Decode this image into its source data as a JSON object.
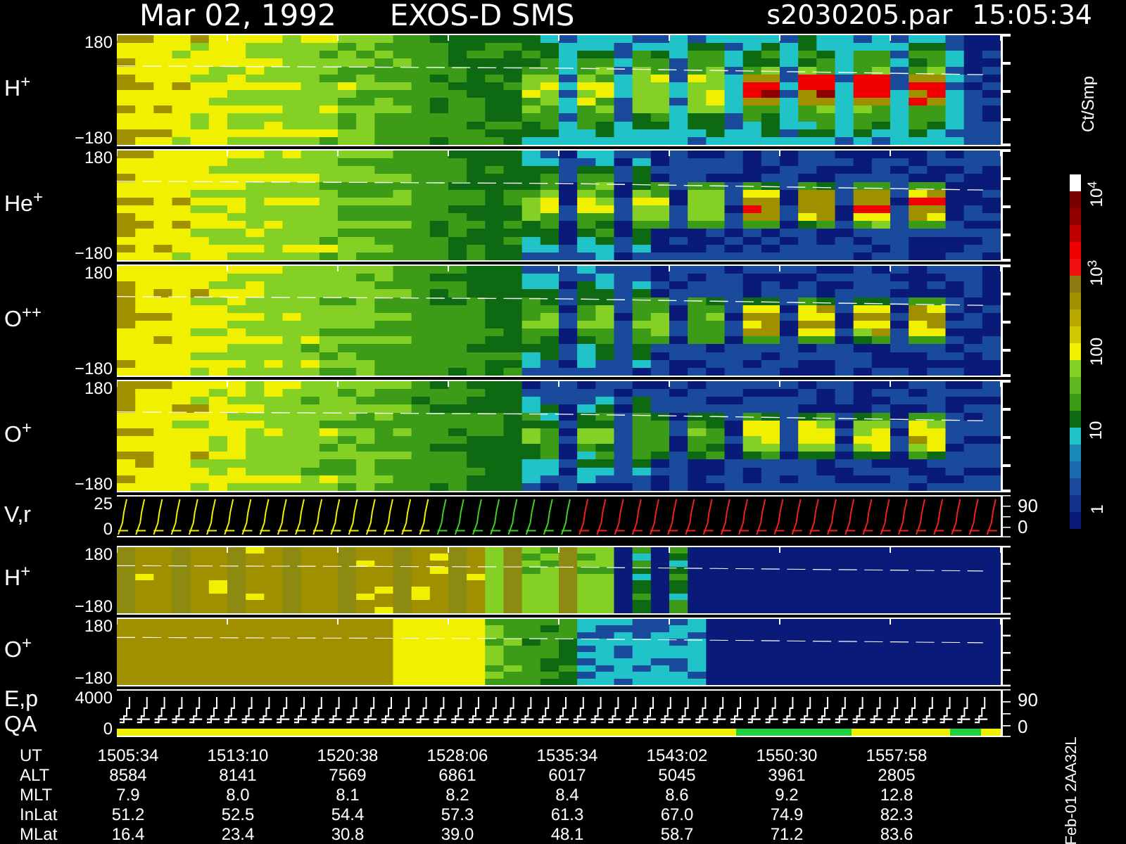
{
  "header": {
    "date": "Mar 02, 1992",
    "mission": "EXOS-D SMS",
    "file": "s2030205.par",
    "time": "15:05:34"
  },
  "panels": [
    {
      "kind": "pitch",
      "labels": [
        "H$^{+}$"
      ],
      "left_ticks": [
        "180",
        "−180"
      ]
    },
    {
      "kind": "pitch",
      "labels": [
        "He$^{+}$"
      ],
      "left_ticks": [
        "180",
        "−180"
      ]
    },
    {
      "kind": "pitch",
      "labels": [
        "O$^{++}$"
      ],
      "left_ticks": [
        "180",
        "−180"
      ]
    },
    {
      "kind": "pitch",
      "labels": [
        "O$^{+}$"
      ],
      "left_ticks": [
        "180",
        "−180"
      ]
    },
    {
      "kind": "velocity",
      "labels": [
        "V,r"
      ],
      "left_ticks": [
        "25",
        "0"
      ],
      "right_ticks": [
        "90",
        "0"
      ]
    },
    {
      "kind": "energy",
      "labels": [
        "H$^{+}$"
      ],
      "left_ticks": [
        "180",
        "−180"
      ]
    },
    {
      "kind": "energy",
      "labels": [
        "O$^{+}$"
      ],
      "left_ticks": [
        "180",
        "−180"
      ]
    },
    {
      "kind": "steps",
      "labels": [
        "E,p",
        "QA"
      ],
      "left_ticks": [
        "4000",
        "0"
      ],
      "right_ticks": [
        "90",
        "0"
      ]
    }
  ],
  "colorbar": {
    "unit": "Ct/Smp",
    "labels": [
      "10$^{4}$",
      "10$^{3}$",
      "100",
      "10",
      "1"
    ]
  },
  "table": [
    {
      "label": "UT",
      "values": [
        "1505:34",
        "1513:10",
        "1520:38",
        "1528:06",
        "1535:34",
        "1543:02",
        "1550:30",
        "1557:58"
      ]
    },
    {
      "label": "ALT",
      "values": [
        "8584",
        "8141",
        "7569",
        "6861",
        "6017",
        "5045",
        "3961",
        "2805"
      ]
    },
    {
      "label": "MLT",
      "values": [
        "7.9",
        "8.0",
        "8.1",
        "8.2",
        "8.4",
        "8.6",
        "9.2",
        "12.8"
      ]
    },
    {
      "label": "InLat",
      "values": [
        "51.2",
        "52.5",
        "54.4",
        "57.3",
        "61.3",
        "67.0",
        "74.9",
        "82.3"
      ]
    },
    {
      "label": "MLat",
      "values": [
        "16.4",
        "23.4",
        "30.8",
        "39.0",
        "48.1",
        "58.7",
        "71.2",
        "83.6"
      ]
    }
  ],
  "footer": "Feb-01 2AA32L"
}
